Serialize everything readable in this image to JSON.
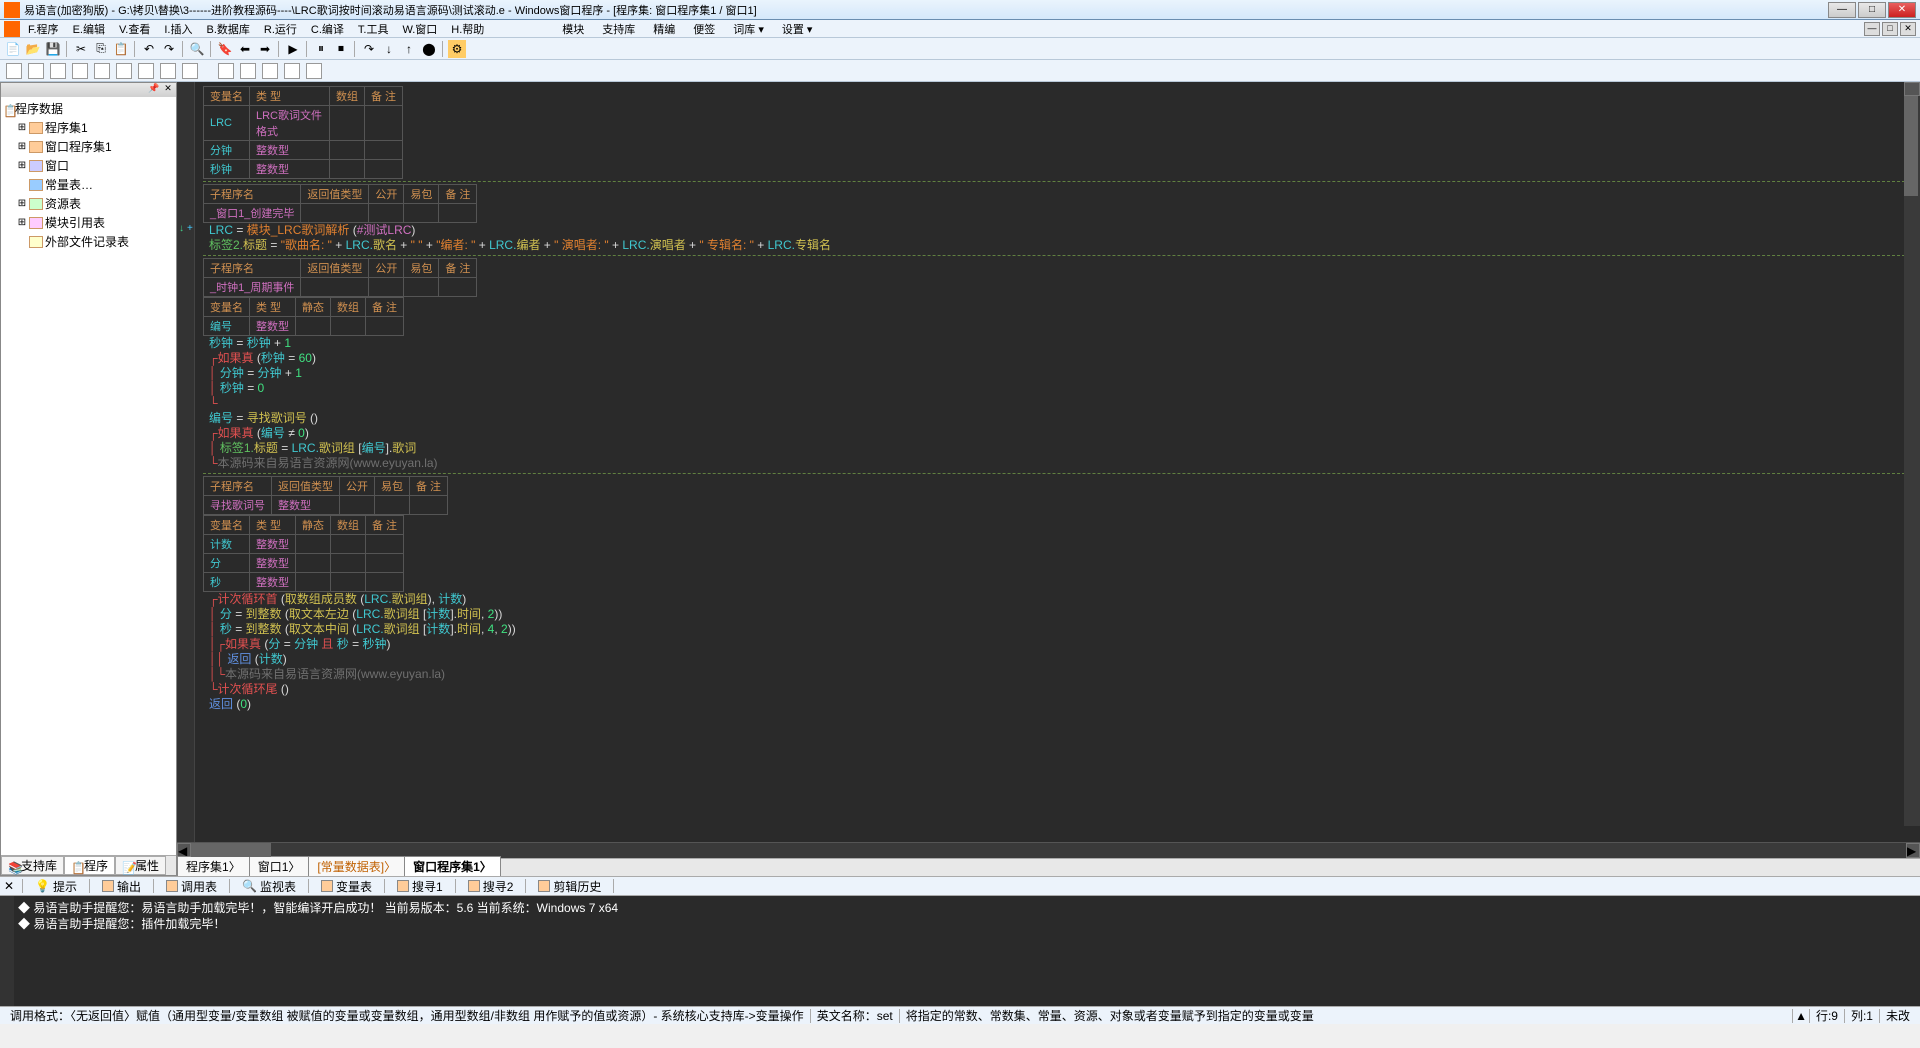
{
  "window": {
    "title": "易语言(加密狗版) - G:\\拷贝\\替换\\3------进阶教程源码----\\LRC歌词按时间滚动易语言源码\\测试滚动.e - Windows窗口程序 - [程序集: 窗口程序集1 / 窗口1]",
    "min": "—",
    "max": "□",
    "close": "✕"
  },
  "menu": {
    "items": [
      "F.程序",
      "E.编辑",
      "V.查看",
      "I.插入",
      "B.数据库",
      "R.运行",
      "C.编译",
      "T.工具",
      "W.窗口",
      "H.帮助"
    ],
    "right": [
      "模块",
      "支持库",
      "精编",
      "便签",
      "词库 ▾",
      "设置 ▾"
    ]
  },
  "tree": {
    "root": "程序数据",
    "n1": "程序集1",
    "n2": "窗口程序集1",
    "n3": "窗口",
    "n4": "常量表…",
    "n5": "资源表",
    "n6": "模块引用表",
    "n7": "外部文件记录表"
  },
  "sidetabs": {
    "t1": "支持库",
    "t2": "程序",
    "t3": "属性"
  },
  "headers": {
    "varname": "变量名",
    "type": "类 型",
    "array": "数组",
    "note": "备 注",
    "subname": "子程序名",
    "rettype": "返回值类型",
    "public": "公开",
    "easy": "易包",
    "static": "静态"
  },
  "vars1": {
    "r1c1": "LRC",
    "r1c2": "LRC歌词文件格式",
    "r2c1": "分钟",
    "r2c2": "整数型",
    "r3c1": "秒钟",
    "r3c2": "整数型"
  },
  "sub1": {
    "name": "_窗口1_创建完毕"
  },
  "code1": {
    "l1a": "LRC",
    "l1b": " = ",
    "l1c": "模块_LRC歌词解析",
    "l1d": " (",
    "l1e": "#测试LRC",
    "l1f": ")",
    "l2a": "标签2.",
    "l2b": "标题",
    "l2c": " = ",
    "l2d": "\"歌曲名: \"",
    "l2e": " + ",
    "l2f": "LRC.",
    "l2g": "歌名",
    "l2h": " + ",
    "l2i": "\"  \"",
    "l2j": " + ",
    "l2k": "\"编者: \"",
    "l2l": " + ",
    "l2m": "LRC.",
    "l2n": "编者",
    "l2o": " + ",
    "l2p": "\"  演唱者: \"",
    "l2q": " + ",
    "l2r": "LRC.",
    "l2s": "演唱者",
    "l2t": " + ",
    "l2u": "\"  专辑名: \"",
    "l2v": " + ",
    "l2w": "LRC.",
    "l2x": "专辑名"
  },
  "sub2": {
    "name": "_时钟1_周期事件"
  },
  "vars2": {
    "r1c1": "编号",
    "r1c2": "整数型"
  },
  "code2": {
    "l1": "秒钟 = 秒钟 + 1",
    "l2a": "如果真",
    "l2b": " (",
    "l2c": "秒钟",
    "l2d": " = ",
    "l2e": "60",
    "l2f": ")",
    "l3": "分钟 = 分钟 + 1",
    "l4": "秒钟 = 0",
    "l5a": "编号",
    "l5b": " = ",
    "l5c": "寻找歌词号",
    "l5d": " ()",
    "l6a": "如果真",
    "l6b": " (",
    "l6c": "编号",
    "l6d": " ≠ ",
    "l6e": "0",
    "l6f": ")",
    "l7a": "标签1.",
    "l7b": "标题",
    "l7c": " = ",
    "l7d": "LRC.",
    "l7e": "歌词组",
    "l7f": " [",
    "l7g": "编号",
    "l7h": "].",
    "l7i": "歌词",
    "cm": "本源码来自易语言资源网(www.eyuyan.la)"
  },
  "sub3": {
    "name": "寻找歌词号",
    "ret": "整数型"
  },
  "vars3": {
    "r1c1": "计数",
    "r1c2": "整数型",
    "r2c1": "分",
    "r2c2": "整数型",
    "r3c1": "秒",
    "r3c2": "整数型"
  },
  "code3": {
    "l1a": "计次循环首",
    "l1b": " (",
    "l1c": "取数组成员数",
    "l1d": " (",
    "l1e": "LRC.",
    "l1f": "歌词组",
    "l1g": "), ",
    "l1h": "计数",
    "l1i": ")",
    "l2a": "分",
    "l2b": " = ",
    "l2c": "到整数",
    "l2d": " (",
    "l2e": "取文本左边",
    "l2f": " (",
    "l2g": "LRC.",
    "l2h": "歌词组",
    "l2i": " [",
    "l2j": "计数",
    "l2k": "].",
    "l2l": "时间",
    "l2m": ", ",
    "l2n": "2",
    "l2o": "))",
    "l3a": "秒",
    "l3b": " = ",
    "l3c": "到整数",
    "l3d": " (",
    "l3e": "取文本中间",
    "l3f": " (",
    "l3g": "LRC.",
    "l3h": "歌词组",
    "l3i": " [",
    "l3j": "计数",
    "l3k": "].",
    "l3l": "时间",
    "l3m": ", ",
    "l3n": "4",
    "l3o": ", ",
    "l3p": "2",
    "l3q": "))",
    "l4a": "如果真",
    "l4b": " (",
    "l4c": "分",
    "l4d": " = ",
    "l4e": "分钟",
    "l4f": " 且 ",
    "l4g": "秒",
    "l4h": " = ",
    "l4i": "秒钟",
    "l4j": ")",
    "l5a": "返回",
    "l5b": " (",
    "l5c": "计数",
    "l5d": ")",
    "cm": "本源码来自易语言资源网(www.eyuyan.la)",
    "l6a": "计次循环尾",
    "l6b": " ()",
    "l7a": "返回",
    "l7b": " (",
    "l7c": "0",
    "l7d": ")"
  },
  "edtabs": {
    "t1": "程序集1",
    "t2": "窗口1",
    "t3": "[常量数据表]",
    "t4": "窗口程序集1"
  },
  "btabs": {
    "t1": "提示",
    "t2": "输出",
    "t3": "调用表",
    "t4": "监视表",
    "t5": "变量表",
    "t6": "搜寻1",
    "t7": "搜寻2",
    "t8": "剪辑历史"
  },
  "console": {
    "l1": "◆ 易语言助手提醒您：易语言助手加载完毕！，智能编译开启成功！ 当前易版本：5.6  当前系统：Windows 7 x64",
    "l2": "◆ 易语言助手提醒您：插件加载完毕！"
  },
  "status": {
    "s1": "调用格式：〈无返回值〉赋值（通用型变量/变量数组 被赋值的变量或变量数组，通用型数组/非数组 用作赋予的值或资源）- 系统核心支持库->变量操作",
    "s2": "英文名称：set",
    "s3": "将指定的常数、常数集、常量、资源、对象或者变量赋予到指定的变量或变量",
    "s4": "行:9",
    "s5": "列:1",
    "s6": "未改"
  }
}
